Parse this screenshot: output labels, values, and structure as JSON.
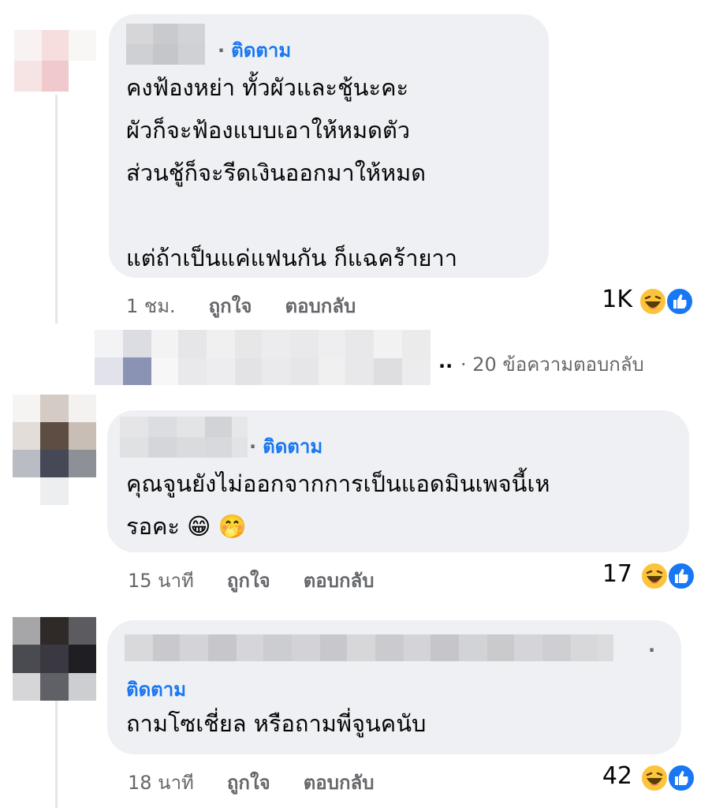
{
  "comments": [
    {
      "follow_label": "ติดตาม",
      "text_lines": [
        "คงฟ้องหย่า ทั้วผัวและชู้นะคะ",
        "ผัวก็จะฟ้องแบบเอาให้หมดตัว",
        "ส่วนชู้ก็จะรีดเงินออกมาให้หมด",
        "",
        "แต่ถ้าเป็นแค่แฟนกัน ก็แฉคร้ายาา"
      ],
      "time": "1 ชม.",
      "like_label": "ถูกใจ",
      "reply_label": "ตอบกลับ",
      "reaction_count": "1K"
    },
    {
      "follow_label": "ติดตาม",
      "text_lines": [
        "คุณจูนยังไม่ออกจากการเป็นแอดมินเพจนี้เห",
        "รอคะ 😁 🤭"
      ],
      "time": "15 นาที",
      "like_label": "ถูกใจ",
      "reply_label": "ตอบกลับ",
      "reaction_count": "17"
    },
    {
      "follow_label": "ติดตาม",
      "text_lines": [
        "ถามโซเชี่ยล หรือถามพี่จูนคนับ"
      ],
      "time": "18 นาที",
      "like_label": "ถูกใจ",
      "reply_label": "ตอบกลับ",
      "reaction_count": "42"
    }
  ],
  "replies_link": "· 20 ข้อความตอบกลับ",
  "replies_ellipsis": "..",
  "name_separator": "·",
  "icons": [
    "haha-reaction-icon",
    "like-reaction-icon"
  ],
  "colors": {
    "accent": "#1877f2",
    "bubble": "#eef0f3",
    "meta": "#65676b"
  }
}
